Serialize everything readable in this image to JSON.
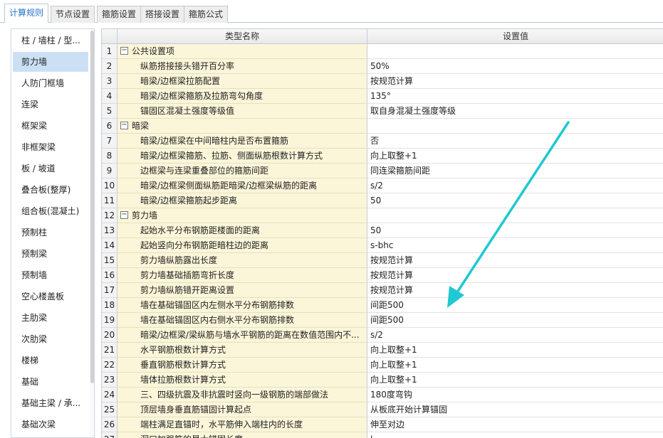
{
  "tabs": [
    {
      "label": "计算规则",
      "active": true
    },
    {
      "label": "节点设置",
      "active": false
    },
    {
      "label": "箍筋设置",
      "active": false
    },
    {
      "label": "搭接设置",
      "active": false
    },
    {
      "label": "箍筋公式",
      "active": false
    }
  ],
  "sidebar": {
    "items": [
      {
        "label": "柱 / 墙柱 / 型..."
      },
      {
        "label": "剪力墙",
        "active": true
      },
      {
        "label": "人防门框墙"
      },
      {
        "label": "连梁"
      },
      {
        "label": "框架梁"
      },
      {
        "label": "非框架梁"
      },
      {
        "label": "板 / 坡道"
      },
      {
        "label": "叠合板(整厚)"
      },
      {
        "label": "组合板(混凝土)"
      },
      {
        "label": "预制柱"
      },
      {
        "label": "预制梁"
      },
      {
        "label": "预制墙"
      },
      {
        "label": "空心楼盖板"
      },
      {
        "label": "主肋梁"
      },
      {
        "label": "次肋梁"
      },
      {
        "label": "楼梯"
      },
      {
        "label": "基础"
      },
      {
        "label": "基础主梁 / 承..."
      },
      {
        "label": "基础次梁"
      }
    ]
  },
  "grid": {
    "headers": {
      "name": "类型名称",
      "value": "设置值"
    },
    "rows": [
      {
        "num": "1",
        "name": "公共设置项",
        "value": "",
        "group": true,
        "toggle": "−"
      },
      {
        "num": "2",
        "name": "纵筋搭接接头错开百分率",
        "value": "50%"
      },
      {
        "num": "3",
        "name": "暗梁/边框梁拉筋配置",
        "value": "按规范计算"
      },
      {
        "num": "4",
        "name": "暗梁/边框梁箍筋及拉筋弯勾角度",
        "value": "135°"
      },
      {
        "num": "5",
        "name": "锚固区混凝土强度等级值",
        "value": "取自身混凝土强度等级"
      },
      {
        "num": "6",
        "name": "暗梁",
        "value": "",
        "group": true,
        "toggle": "−"
      },
      {
        "num": "7",
        "name": "暗梁/边框梁在中间暗柱内是否布置箍筋",
        "value": "否"
      },
      {
        "num": "8",
        "name": "暗梁/边框梁箍筋、拉筋、侧面纵筋根数计算方式",
        "value": "向上取整+1"
      },
      {
        "num": "9",
        "name": "边框梁与连梁重叠部位的箍筋间距",
        "value": "同连梁箍筋间距"
      },
      {
        "num": "10",
        "name": "暗梁/边框梁侧面纵筋距暗梁/边框梁纵筋的距离",
        "value": "s/2"
      },
      {
        "num": "11",
        "name": "暗梁/边框梁箍筋起步距离",
        "value": "50"
      },
      {
        "num": "12",
        "name": "剪力墙",
        "value": "",
        "group": true,
        "toggle": "−"
      },
      {
        "num": "13",
        "name": "起始水平分布钢筋距楼面的距离",
        "value": "50"
      },
      {
        "num": "14",
        "name": "起始竖向分布钢筋距暗柱边的距离",
        "value": "s-bhc"
      },
      {
        "num": "15",
        "name": "剪力墙纵筋露出长度",
        "value": "按规范计算"
      },
      {
        "num": "16",
        "name": "剪力墙基础插筋弯折长度",
        "value": "按规范计算"
      },
      {
        "num": "17",
        "name": "剪力墙纵筋错开距离设置",
        "value": "按规范计算"
      },
      {
        "num": "18",
        "name": "墙在基础锚固区内左侧水平分布钢筋排数",
        "value": "间距500"
      },
      {
        "num": "19",
        "name": "墙在基础锚固区内右侧水平分布钢筋排数",
        "value": "间距500"
      },
      {
        "num": "20",
        "name": "暗梁/边框梁/梁纵筋与墙水平钢筋的距离在数值范围内不...",
        "value": "s/2"
      },
      {
        "num": "21",
        "name": "水平钢筋根数计算方式",
        "value": "向上取整+1"
      },
      {
        "num": "22",
        "name": "垂直钢筋根数计算方式",
        "value": "向上取整+1"
      },
      {
        "num": "23",
        "name": "墙体拉筋根数计算方式",
        "value": "向上取整+1"
      },
      {
        "num": "24",
        "name": "三、四级抗震及非抗震时竖向一级钢筋的端部做法",
        "value": "180度弯钩"
      },
      {
        "num": "25",
        "name": "顶层墙身垂直筋锚固计算起点",
        "value": "从板底开始计算锚固"
      },
      {
        "num": "26",
        "name": "端柱满足直锚时，水平筋伸入端柱内的长度",
        "value": "伸至对边"
      },
      {
        "num": "27",
        "name": "洞口加强筋的最大锚固长度",
        "value": "l"
      }
    ]
  },
  "colors": {
    "accent": "#2a73c9",
    "selected_bg": "#cbe0f5",
    "name_col_bg": "#fbf6d9",
    "arrow": "#1fc8d2"
  }
}
